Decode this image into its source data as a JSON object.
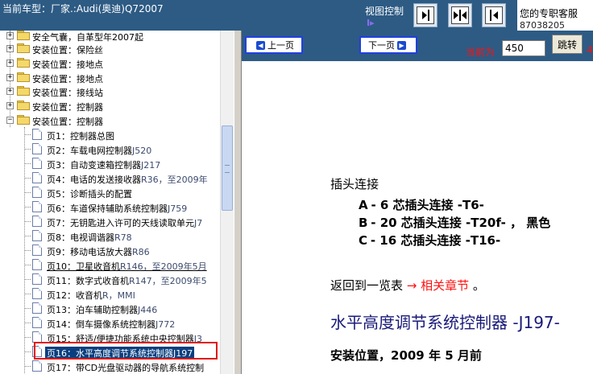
{
  "header": {
    "car_model": "当前车型：厂家.:Audi(奥迪)Q72007",
    "view_control_label": "视图控制",
    "view_marker": "I▸",
    "service_label": "您的专职客服",
    "service_phone": "87038205",
    "view_buttons": [
      "panel-right-icon",
      "panel-split-icon",
      "panel-left-icon"
    ]
  },
  "tree": {
    "folders": [
      {
        "label": "安全气囊，自革型年2007起"
      },
      {
        "label": "安装位置：保险丝"
      },
      {
        "label": "安装位置：接地点"
      },
      {
        "label": "安装位置：接地点"
      },
      {
        "label": "安装位置：接线站"
      },
      {
        "label": "安装位置：控制器"
      },
      {
        "label": "安装位置：控制器"
      }
    ],
    "pages": [
      {
        "prefix": "页1：",
        "text": "控制器总图",
        "code": ""
      },
      {
        "prefix": "页2：",
        "text": "车载电网控制器",
        "code": "J520"
      },
      {
        "prefix": "页3：",
        "text": "自动变速箱控制器",
        "code": "J217"
      },
      {
        "prefix": "页4：",
        "text": "电话的发送接收器",
        "code": "R36，至2009年"
      },
      {
        "prefix": "页5：",
        "text": "诊断插头的配置",
        "code": ""
      },
      {
        "prefix": "页6：",
        "text": "车道保持辅助系统控制器",
        "code": "J759"
      },
      {
        "prefix": "页7：",
        "text": "无钥匙进入许可的天线读取单元",
        "code": "J7"
      },
      {
        "prefix": "页8：",
        "text": "电视调谐器",
        "code": "R78"
      },
      {
        "prefix": "页9：",
        "text": "移动电话放大器",
        "code": "R86"
      },
      {
        "prefix": "页10：",
        "text": "卫星收音机",
        "code": "R146，至2009年5月"
      },
      {
        "prefix": "页11：",
        "text": "数字式收音机",
        "code": "R147，至2009年5"
      },
      {
        "prefix": "页12：",
        "text": "收音机",
        "code": "R，MMI"
      },
      {
        "prefix": "页13：",
        "text": "泊车辅助控制器",
        "code": "J446"
      },
      {
        "prefix": "页14：",
        "text": "倒车摄像系统控制器",
        "code": "J772"
      },
      {
        "prefix": "页15：",
        "text": "舒适/便捷功能系统中央控制器",
        "code": "J3"
      },
      {
        "prefix": "页16：",
        "text": "水平高度调节系统控制器",
        "code": "J197"
      },
      {
        "prefix": "页17：",
        "text": "带CD光盘驱动器的导航系统控制",
        "code": ""
      }
    ]
  },
  "nav": {
    "prev_label": "上一页",
    "next_label": "下一页",
    "current_label": "当前为",
    "page_value": "450",
    "jump_label": "跳转",
    "extra": "4"
  },
  "content": {
    "plug_heading": "插头连接",
    "pins": [
      {
        "letter": "A",
        "text": "- 6 芯插头连接 -T6-"
      },
      {
        "letter": "B",
        "text": "- 20 芯插头连接 -T20f- ， 黑色"
      },
      {
        "letter": "C",
        "text": "- 16 芯插头连接 -T16-"
      }
    ],
    "back_prefix": "返回到一览表",
    "back_arrow": "→ 相关章节",
    "back_suffix": " 。",
    "section_heading": "水平高度调节系统控制器 -J197-",
    "install_line": "安装位置，2009 年 5 月前"
  },
  "colors": {
    "header_bg": "#2d5b84",
    "selection_bg": "#0a3f7f",
    "highlight_border": "#e01818",
    "link_red": "#ff1010"
  }
}
